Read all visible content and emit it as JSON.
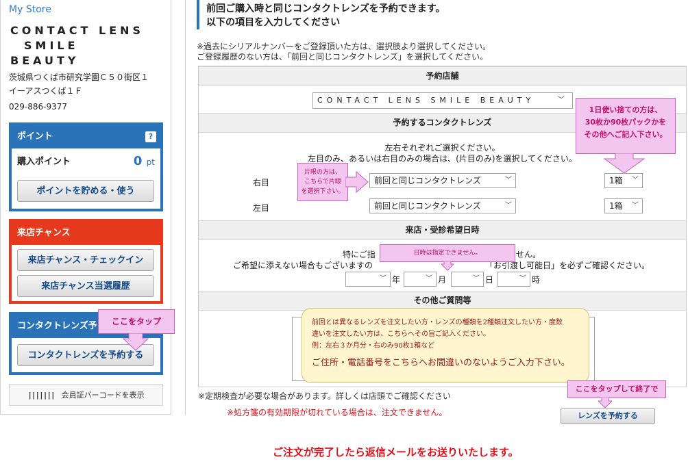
{
  "sidebar": {
    "store_link": "My Store",
    "store_name_line1": "CONTACT LENS",
    "store_name_line2": "SMILE",
    "store_name_line3": "BEAUTY",
    "address_line1": "茨城県つくば市研究学園Ｃ５０街区１",
    "address_line2": "イーアスつくば１Ｆ",
    "phone": "029-886-9377",
    "point_panel": {
      "title": "ポイント",
      "help": "?",
      "label": "購入ポイント",
      "value": "0",
      "unit": "pt",
      "button": "ポイントを貯める・使う"
    },
    "visit_panel": {
      "title": "来店チャンス",
      "button1": "来店チャンス・チェックイン",
      "button2": "来店チャンス当選履歴"
    },
    "contact_panel": {
      "title": "コンタクトレンズ予",
      "button": "コンタクトレンズを予約する"
    },
    "barcode_button": "会員証バーコードを表示"
  },
  "main": {
    "title_line1": "前回ご購入時と同じコンタクトレンズを予約できます。",
    "title_line2": "以下の項目を入力してください",
    "intro_line1": "※過去にシリアルナンバーをご登録頂いた方は、選択肢より選択してください。",
    "intro_line2": "ご登録履歴のない方は、「前回と同じコンタクトレンズ」を選択してください。",
    "sections": {
      "store": "予約店舗",
      "lens": "予約するコンタクトレンズ",
      "visit": "来店・受診希望日時",
      "other": "その他ご質問等"
    },
    "store_select": "CONTACT LENS SMILE BEAUTY",
    "lens_note_line1": "左右それぞれご選択ください。",
    "lens_note_line2": "左目のみ、あるいは右目のみの場合は、(片目のみ)を選択してください。",
    "right_eye_label": "右目",
    "left_eye_label": "左目",
    "lens_option": "前回と同じコンタクトレンズ",
    "qty_option": "1箱",
    "visit_note_line1_a": "特にご指",
    "visit_note_line1_b": "せん。",
    "visit_note_line2_a": "ご希望に添えない場合もございますの",
    "visit_note_line2_b": "「お引渡し可能日」を必ずご確認ください。",
    "date_units": {
      "year": "年",
      "month": "月",
      "day": "日",
      "hour": "時"
    },
    "footer_note": "※定期検査が必要な場合があります。詳しくは店頭でご確認ください",
    "prescription_note": "※処方箋の有効期限が切れている場合は、注文できません。",
    "submit_button": "レンズを予約する",
    "bottom_notice": "ご注文が完了したら返信メールをお送りいたします。"
  },
  "annotations": {
    "tap_here": "ここをタップ",
    "single_eye_1": "片眼の方は、",
    "single_eye_2": "こちらで片眼",
    "single_eye_3": "を選択下さい。",
    "daily_1": "1日使い捨ての方は、",
    "daily_2": "30枚か90枚パックかを",
    "daily_3": "その他へご記入下さい。",
    "no_date": "日時は指定できません。",
    "note_line1": "前回とは異なるレンズを注文したい方・レンズの種類を2種類注文したい方・度数",
    "note_line2": "違いを注文したい方は、こちらへその旨ご記入ください。",
    "note_line3": "例：左右３か月分・右のみ90枚1箱など",
    "note_big": "ご住所・電話番号をこちらへお間違いのないようご入力下さい。",
    "tap_finish": "ここをタップして終了で"
  },
  "colors": {
    "blue": "#2a73b8",
    "red": "#e63a1e",
    "callout_bg": "#f3c6f0",
    "callout_text": "#c0106a",
    "notice_red": "#e0101a"
  }
}
